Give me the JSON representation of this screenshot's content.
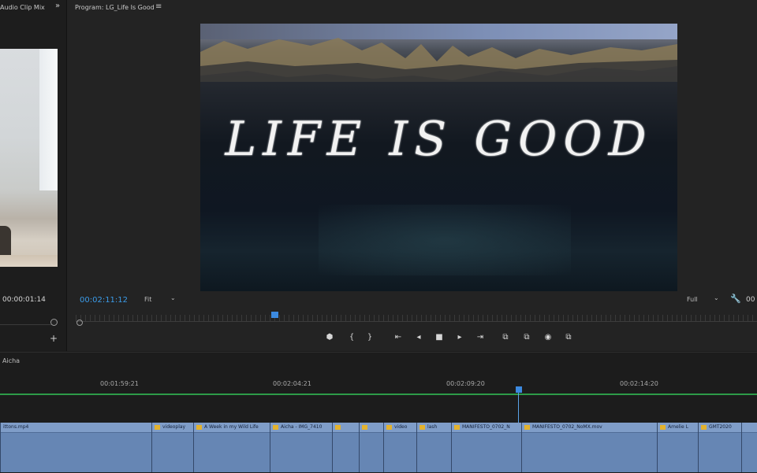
{
  "source_panel": {
    "tab_label": "Audio Clip Mix",
    "more_icon": "double-chevron-right",
    "timecode": "00:00:01:14",
    "add_icon": "+"
  },
  "program_panel": {
    "tab_label": "Program: LG_Life Is Good",
    "menu_icon": "≡",
    "video_title": "LIFE IS GOOD",
    "timecode": "00:02:11:12",
    "zoom": "Fit",
    "resolution": "Full",
    "playhead_fraction": 0.29,
    "controls": [
      "add-marker",
      "mark-in",
      "mark-out",
      "go-to-in",
      "step-back",
      "stop",
      "step-forward",
      "go-to-out",
      "insert",
      "overwrite",
      "export-frame",
      "compare"
    ],
    "control_glyphs": [
      "⬢",
      "{",
      "}",
      "⇤",
      "◂",
      "■",
      "▸",
      "⇥",
      "⧉",
      "⧉",
      "◉",
      "⧉"
    ]
  },
  "timeline": {
    "sequence_name": "Aicha",
    "ruler": [
      "00:01:59:21",
      "00:02:04:21",
      "00:02:09:20",
      "00:02:14:20"
    ],
    "playhead_fraction": 0.685,
    "clips": [
      {
        "label": "ittons.mp4",
        "fx": false
      },
      {
        "label": "videoplay",
        "fx": true
      },
      {
        "label": "A Week in my Wild Life",
        "fx": true
      },
      {
        "label": "Aicha - IMG_7410",
        "fx": true
      },
      {
        "label": "",
        "fx": true
      },
      {
        "label": "",
        "fx": true
      },
      {
        "label": "video",
        "fx": true
      },
      {
        "label": "lash",
        "fx": true
      },
      {
        "label": "MANIFESTO_0702_N",
        "fx": true
      },
      {
        "label": "MANIFESTO_0702_NoMX.mov",
        "fx": true
      },
      {
        "label": "Amelie L",
        "fx": true
      },
      {
        "label": "GMT2020",
        "fx": true
      },
      {
        "label": "",
        "fx": false
      }
    ]
  },
  "colors": {
    "accent": "#3b9be8",
    "track": "#6686b4",
    "audio_line": "#2d9b48"
  }
}
